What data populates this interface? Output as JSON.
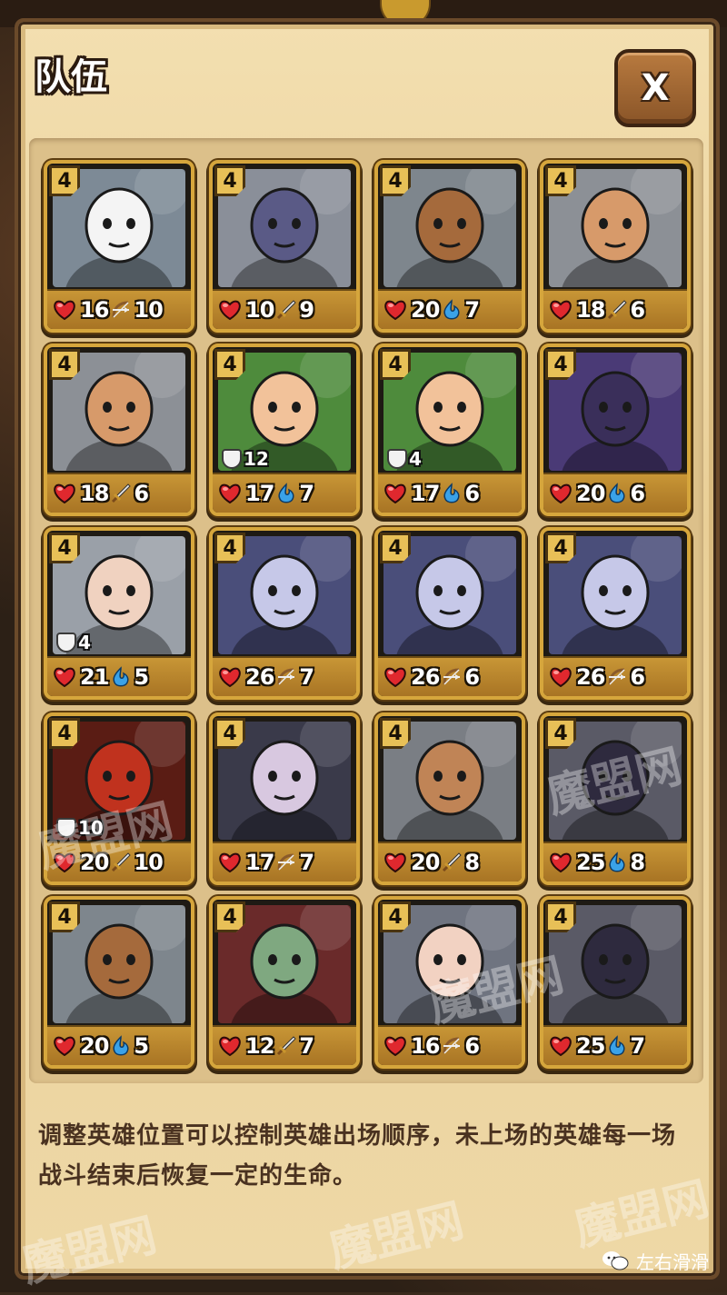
{
  "dialog": {
    "title": "队伍",
    "close_label": "X"
  },
  "heroes": [
    {
      "level": "4",
      "hp": "16",
      "type": "bow",
      "atk": "10",
      "portrait": "panda-hero",
      "bg": "#7d8a96",
      "skin": "#f4f4f4"
    },
    {
      "level": "4",
      "hp": "10",
      "type": "sword",
      "atk": "9",
      "portrait": "armored-knight",
      "bg": "#8a8f99",
      "skin": "#5a5a86"
    },
    {
      "level": "4",
      "hp": "20",
      "type": "magic",
      "atk": "7",
      "portrait": "pharaoh-hero",
      "bg": "#7e868d",
      "skin": "#a56a3c"
    },
    {
      "level": "4",
      "hp": "18",
      "type": "sword",
      "atk": "6",
      "portrait": "warrior-girl",
      "bg": "#8c9096",
      "skin": "#d79a6a"
    },
    {
      "level": "4",
      "hp": "18",
      "type": "sword",
      "atk": "6",
      "portrait": "warrior-girl",
      "bg": "#8c9096",
      "skin": "#d79a6a"
    },
    {
      "level": "4",
      "hp": "17",
      "type": "magic",
      "atk": "7",
      "portrait": "elf-girl",
      "bg": "#4e8b3c",
      "skin": "#f2c29a",
      "shield": "12"
    },
    {
      "level": "4",
      "hp": "17",
      "type": "magic",
      "atk": "6",
      "portrait": "elf-girl",
      "bg": "#4e8b3c",
      "skin": "#f2c29a",
      "shield": "4"
    },
    {
      "level": "4",
      "hp": "20",
      "type": "magic",
      "atk": "6",
      "portrait": "dark-mage",
      "bg": "#4a3a76",
      "skin": "#3a2f5a"
    },
    {
      "level": "4",
      "hp": "21",
      "type": "magic",
      "atk": "5",
      "portrait": "white-priestess",
      "bg": "#9aa0a8",
      "skin": "#f0d2c0",
      "shield": "4"
    },
    {
      "level": "4",
      "hp": "26",
      "type": "bow",
      "atk": "7",
      "portrait": "blue-archer",
      "bg": "#4a4e7a",
      "skin": "#c6c8e8"
    },
    {
      "level": "4",
      "hp": "26",
      "type": "bow",
      "atk": "6",
      "portrait": "blue-archer",
      "bg": "#4a4e7a",
      "skin": "#c6c8e8"
    },
    {
      "level": "4",
      "hp": "26",
      "type": "bow",
      "atk": "6",
      "portrait": "blue-archer",
      "bg": "#4a4e7a",
      "skin": "#c6c8e8"
    },
    {
      "level": "4",
      "hp": "20",
      "type": "sword",
      "atk": "10",
      "portrait": "fire-demon",
      "bg": "#5a1c14",
      "skin": "#c0321e",
      "shield": "10"
    },
    {
      "level": "4",
      "hp": "17",
      "type": "bow",
      "atk": "7",
      "portrait": "spider-queen",
      "bg": "#3a3a4a",
      "skin": "#d8c8e0"
    },
    {
      "level": "4",
      "hp": "20",
      "type": "sword",
      "atk": "8",
      "portrait": "bearded-paladin",
      "bg": "#7a7e84",
      "skin": "#c08456"
    },
    {
      "level": "4",
      "hp": "25",
      "type": "magic",
      "atk": "8",
      "portrait": "hooded-assassin",
      "bg": "#5a5a66",
      "skin": "#2e2a3e"
    },
    {
      "level": "4",
      "hp": "20",
      "type": "magic",
      "atk": "5",
      "portrait": "pharaoh-hero",
      "bg": "#7e868d",
      "skin": "#a56a3c"
    },
    {
      "level": "4",
      "hp": "12",
      "type": "sword",
      "atk": "7",
      "portrait": "zombie-girl",
      "bg": "#6a2a2a",
      "skin": "#7fa880"
    },
    {
      "level": "4",
      "hp": "16",
      "type": "bow",
      "atk": "6",
      "portrait": "dark-heroine",
      "bg": "#6f7480",
      "skin": "#f2d2c2"
    },
    {
      "level": "4",
      "hp": "25",
      "type": "magic",
      "atk": "7",
      "portrait": "hooded-assassin",
      "bg": "#5a5a66",
      "skin": "#2e2a3e"
    }
  ],
  "info": {
    "text": "调整英雄位置可以控制英雄出场顺序，未上场的英雄每一场战斗结束后恢复一定的生命。"
  },
  "footer": {
    "label": "左右滑滑"
  },
  "watermarks": [
    "魔盟网",
    "魔盟网",
    "魔盟网",
    "魔盟网",
    "魔盟网",
    "魔盟网"
  ],
  "colors": {
    "hp_heart": "#e0282e",
    "magic": "#3aa2e8",
    "frame_gold": "#d6a63c"
  }
}
